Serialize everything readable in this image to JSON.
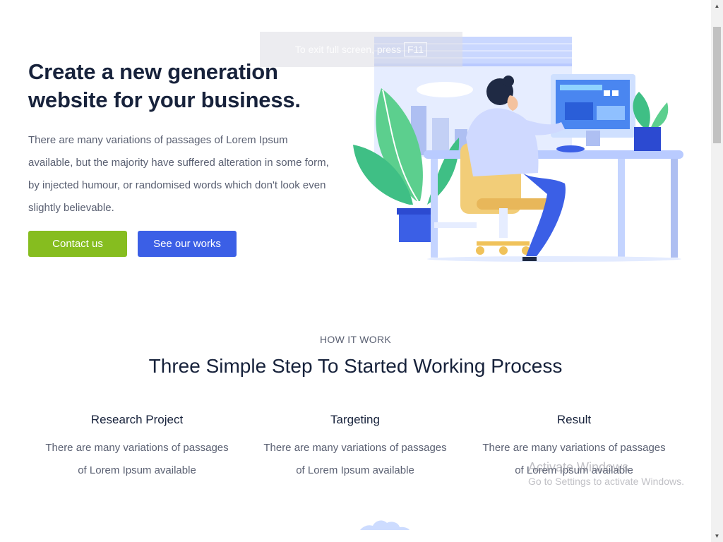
{
  "hero": {
    "title": "Create a new generation website for your business.",
    "description": "There are many variations of passages of Lorem Ipsum available, but the majority have suffered alteration in some form, by injected humour, or randomised words which don't look even slightly believable.",
    "contact_label": "Contact us",
    "works_label": "See our works"
  },
  "overlay": {
    "text": "To exit full screen, press",
    "key": "F11"
  },
  "process": {
    "eyebrow": "HOW IT WORK",
    "title": "Three Simple Step To Started Working Process",
    "steps": [
      {
        "title": "Research Project",
        "description": "There are many variations of passages of Lorem Ipsum available"
      },
      {
        "title": "Targeting",
        "description": "There are many variations of passages of Lorem Ipsum available"
      },
      {
        "title": "Result",
        "description": "There are many variations of passages of Lorem Ipsum available"
      }
    ]
  },
  "watermark": {
    "title": "Activate Windows",
    "subtitle": "Go to Settings to activate Windows."
  },
  "icons": {
    "scroll_up": "scroll-up-arrow-icon",
    "scroll_down": "scroll-down-arrow-icon",
    "plant": "plant-icon",
    "monitor": "monitor-icon",
    "cloud": "cloud-icon"
  },
  "colors": {
    "heading": "#17223b",
    "body_text": "#5a6072",
    "contact_button": "#86bd1f",
    "works_button": "#3b5fe6",
    "illustration_blue": "#3b5fe6",
    "illustration_green": "#3fbf85"
  }
}
